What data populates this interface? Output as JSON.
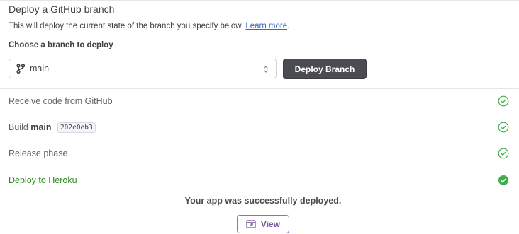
{
  "section": {
    "title": "Deploy a GitHub branch",
    "description": "This will deploy the current state of the branch you specify below.",
    "learn_more": "Learn more",
    "learn_more_period": "."
  },
  "branch_picker": {
    "label": "Choose a branch to deploy",
    "selected": "main",
    "icon": "git-branch-icon",
    "arrows_icon": "select-arrows-icon"
  },
  "deploy_button": {
    "label": "Deploy Branch"
  },
  "steps": [
    {
      "label": "Receive code from GitHub",
      "status": "complete",
      "icon": "check-circle-outline-icon"
    },
    {
      "label_prefix": "Build",
      "label_bold": "main",
      "commit": "202e0eb3",
      "status": "complete",
      "icon": "check-circle-outline-icon"
    },
    {
      "label": "Release phase",
      "status": "complete",
      "icon": "check-circle-outline-icon"
    },
    {
      "label": "Deploy to Heroku",
      "status": "success",
      "icon": "check-circle-filled-icon"
    }
  ],
  "result": {
    "message": "Your app was successfully deployed.",
    "view_label": "View",
    "view_icon": "external-window-icon"
  },
  "colors": {
    "success_green": "#2e8a21",
    "check_green": "#3fae49",
    "link_blue": "#3a66c6",
    "button_dark": "#4b4b53",
    "view_purple": "#79589f"
  }
}
